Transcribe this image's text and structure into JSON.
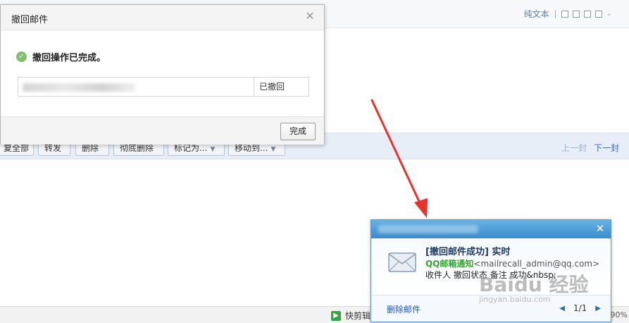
{
  "background_client": {
    "view_tools": {
      "plain_text_label": "纯文本"
    },
    "toolbar": {
      "buttons": [
        {
          "label": "复全部",
          "has_menu": false
        },
        {
          "label": "转发",
          "has_menu": false
        },
        {
          "label": "删除",
          "has_menu": false
        },
        {
          "label": "彻底删除",
          "has_menu": false
        },
        {
          "label": "标记为...",
          "has_menu": true
        },
        {
          "label": "移动到...",
          "has_menu": true
        }
      ],
      "prev_label": "上一封",
      "next_label": "下一封"
    },
    "statusbar": {
      "quickcut_label": "快剪辑",
      "zoom_label": "90%"
    }
  },
  "recall_dialog": {
    "title": "撤回邮件",
    "status_text": "撤回操作已完成。",
    "rows": [
      {
        "recipient": "",
        "state": "已撤回"
      }
    ],
    "done_label": "完成"
  },
  "notification": {
    "subject": "[撤回邮件成功] 实时",
    "sender_name": "QQ邮箱通知",
    "sender_address": "<mailrecall_admin@qq.com>",
    "preview": "收件人 撤回状态 备注 成功&nbsp;",
    "delete_label": "删除邮件",
    "page_indicator": "1/1"
  },
  "watermark": {
    "logo": "Baidu 经验",
    "url": "jingyan.baidu.com"
  },
  "colors": {
    "annotation_arrow": "#e8332a",
    "notify_header": "#3b8ccc",
    "sender_green": "#32a52e",
    "link_blue": "#2459a8"
  }
}
